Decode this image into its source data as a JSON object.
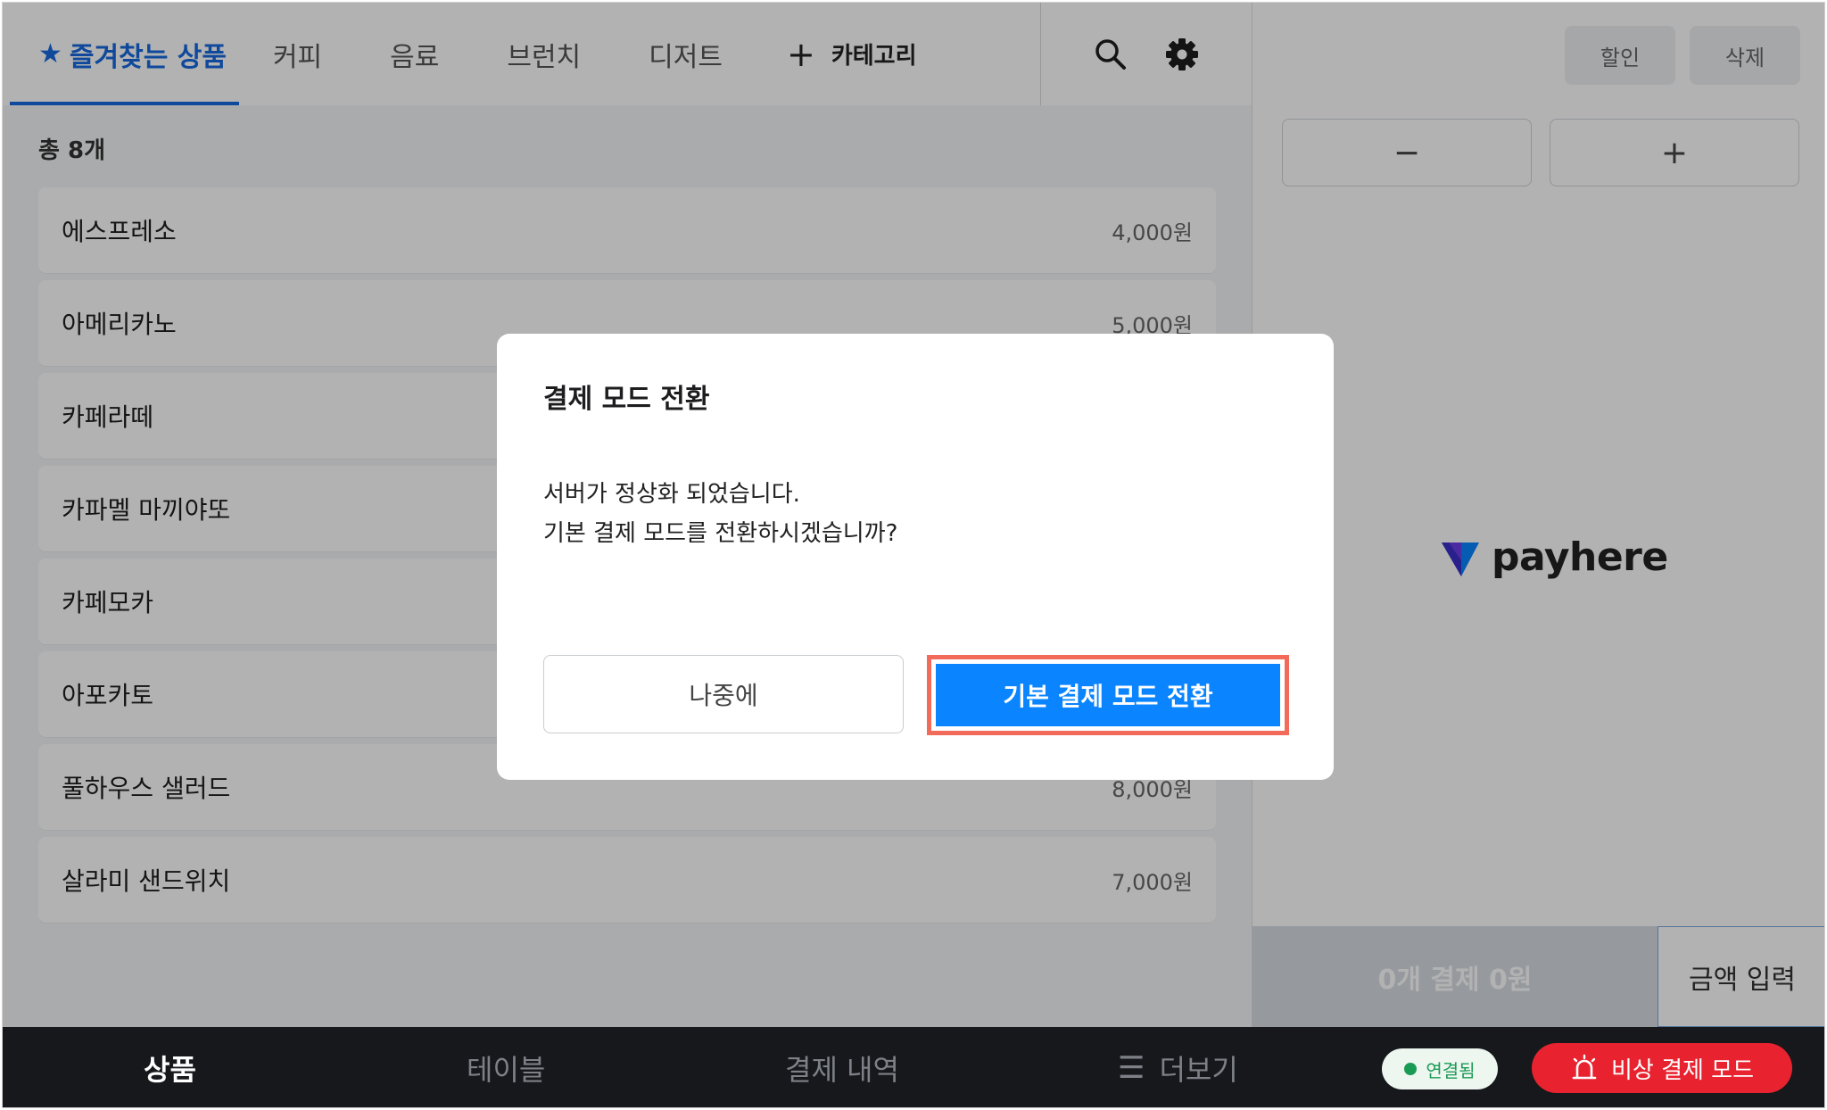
{
  "tabs": [
    {
      "label": "즐겨찾는 상품",
      "icon": "star-icon",
      "active": true
    },
    {
      "label": "커피"
    },
    {
      "label": "음료"
    },
    {
      "label": "브런치"
    },
    {
      "label": "디저트"
    }
  ],
  "star_glyph": "★",
  "add_category_label": "카테고리",
  "product_count": "총 8개",
  "products": [
    {
      "name": "에스프레소",
      "price": "4,000원"
    },
    {
      "name": "아메리카노",
      "price": "5,000원"
    },
    {
      "name": "카페라떼",
      "price": ""
    },
    {
      "name": "카파멜 마끼야또",
      "price": ""
    },
    {
      "name": "카페모카",
      "price": ""
    },
    {
      "name": "아포카토",
      "price": ""
    },
    {
      "name": "풀하우스 샐러드",
      "price": "8,000원"
    },
    {
      "name": "살라미 샌드위치",
      "price": "7,000원"
    }
  ],
  "right_panel": {
    "discount_label": "할인",
    "delete_label": "삭제",
    "minus_label": "−",
    "plus_label": "+",
    "brand": "payhere",
    "pay_label": "0개 결제  0원",
    "amount_label": "금액 입력"
  },
  "bottom_nav": {
    "products": "상품",
    "tables": "테이블",
    "history": "결제 내역",
    "more": "더보기",
    "connection": "연결됨",
    "emergency": "비상 결제 모드"
  },
  "modal": {
    "title": "결제 모드 전환",
    "message_line1": "서버가 정상화 되었습니다.",
    "message_line2": "기본 결제 모드를 전환하시겠습니까?",
    "later_label": "나중에",
    "confirm_label": "기본 결제 모드 전환"
  },
  "colors": {
    "accent": "#1769e0",
    "confirm": "#0a84ff",
    "highlight_border": "#f26a5a",
    "emergency": "#e8232f",
    "connected": "#1a9b54",
    "nav_bg": "#16181c"
  }
}
